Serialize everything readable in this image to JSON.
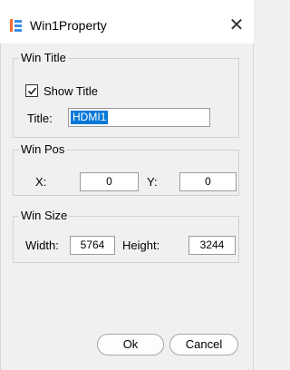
{
  "window": {
    "title": "Win1Property",
    "icon": "app-window-icon",
    "close_glyph": "✕"
  },
  "groups": {
    "win_title": {
      "legend": "Win Title",
      "show_title_label": "Show Title",
      "show_title_checked": true,
      "title_label": "Title:",
      "title_value": "HDMI1"
    },
    "win_pos": {
      "legend": "Win Pos",
      "x_label": "X:",
      "x_value": "0",
      "y_label": "Y:",
      "y_value": "0"
    },
    "win_size": {
      "legend": "Win Size",
      "width_label": "Width:",
      "width_value": "5764",
      "height_label": "Height:",
      "height_value": "3244"
    }
  },
  "buttons": {
    "ok_label": "Ok",
    "cancel_label": "Cancel"
  },
  "colors": {
    "selection": "#0078d7",
    "accent_orange": "#f26b2b",
    "accent_blue": "#3a8ee6"
  }
}
